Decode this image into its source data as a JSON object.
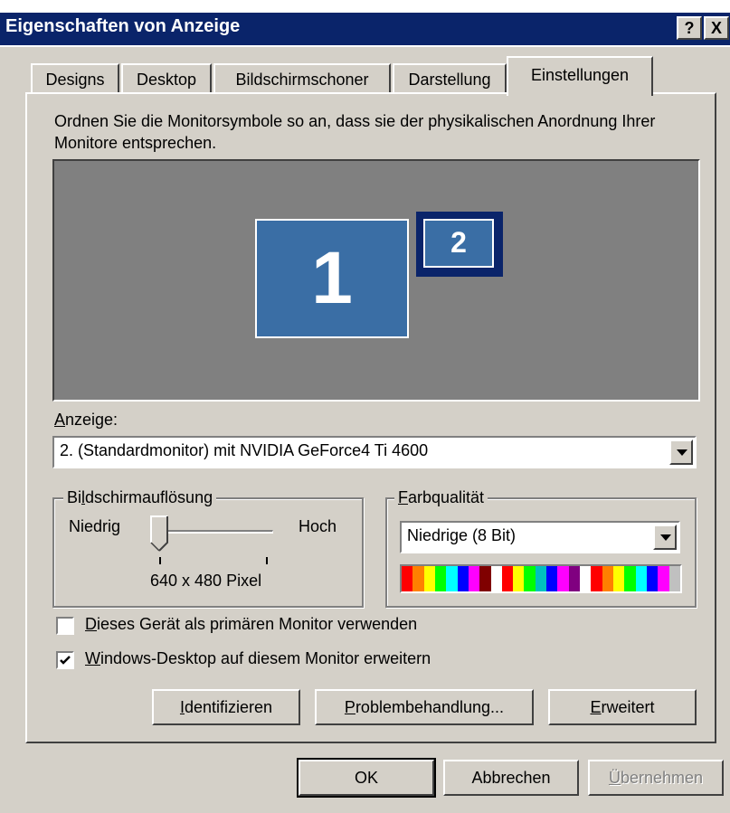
{
  "window": {
    "title": "Eigenschaften von Anzeige",
    "help_label": "?",
    "close_label": "X"
  },
  "tabs": [
    {
      "label": "Designs"
    },
    {
      "label": "Desktop"
    },
    {
      "label": "Bildschirmschoner"
    },
    {
      "label": "Darstellung"
    },
    {
      "label": "Einstellungen",
      "active": true
    }
  ],
  "settings": {
    "description": "Ordnen Sie die Monitorsymbole so an, dass sie der physikalischen Anordnung Ihrer Monitore entsprechen.",
    "monitors": [
      {
        "label": "1"
      },
      {
        "label": "2",
        "selected": true
      }
    ],
    "display_label_mnemonic": "A",
    "display_label_rest": "nzeige:",
    "display_value": "2. (Standardmonitor) mit NVIDIA GeForce4 Ti 4600",
    "resolution": {
      "group_label_pre": "Bi",
      "group_label_mnemonic": "l",
      "group_label_post": "dschirmauflösung",
      "low_label": "Niedrig",
      "high_label": "Hoch",
      "value_text": "640 x 480 Pixel",
      "slider_position": 0
    },
    "color_quality": {
      "group_label_mnemonic": "F",
      "group_label_rest": "arbqualität",
      "value": "Niedrige (8 Bit)"
    },
    "checkboxes": [
      {
        "mnemonic": "D",
        "rest": "ieses Gerät als primären Monitor verwenden",
        "checked": false
      },
      {
        "mnemonic": "W",
        "rest": "indows-Desktop auf diesem Monitor erweitern",
        "checked": true
      }
    ],
    "buttons": {
      "identify_mnemonic": "I",
      "identify_rest": "dentifizieren",
      "troubleshoot_mnemonic": "P",
      "troubleshoot_rest": "roblembehandlung...",
      "advanced_mnemonic": "E",
      "advanced_rest": "rweitert"
    }
  },
  "footer": {
    "ok_label": "OK",
    "cancel_label": "Abbrechen",
    "apply_mnemonic": "Ü",
    "apply_rest": "bernehmen"
  },
  "colors": {
    "titlebar": "#0a246a",
    "face": "#d4d0c8",
    "monitor_area": "#808080",
    "monitor_fill": "#3a6ea5",
    "color_bar": [
      "#ff0000",
      "#ff8000",
      "#ffff00",
      "#00ff00",
      "#00ffff",
      "#0000ff",
      "#ff00ff",
      "#800000",
      "#ffffff",
      "#ff0000",
      "#ffff00",
      "#00ff00",
      "#00c0c0",
      "#0000ff",
      "#ff00ff",
      "#800080",
      "#ffffff",
      "#ff0000",
      "#ff8000",
      "#ffff00",
      "#00ff00",
      "#00ffff",
      "#0000ff",
      "#ff00ff",
      "#c0c0c0"
    ]
  }
}
